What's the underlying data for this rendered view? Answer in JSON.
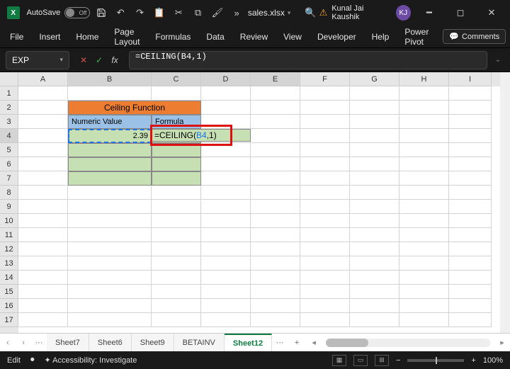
{
  "titlebar": {
    "autosave_label": "AutoSave",
    "autosave_state": "Off",
    "filename": "sales.xlsx",
    "user_name": "Kunal Jai Kaushik",
    "user_initials": "KJ"
  },
  "ribbon": {
    "tabs": [
      "File",
      "Insert",
      "Home",
      "Page Layout",
      "Formulas",
      "Data",
      "Review",
      "View",
      "Developer",
      "Help",
      "Power Pivot"
    ],
    "comments_label": "Comments"
  },
  "formulabar": {
    "namebox": "EXP",
    "formula": "=CEILING(B4,1)"
  },
  "columns": [
    "A",
    "B",
    "C",
    "D",
    "E",
    "F",
    "G",
    "H",
    "I"
  ],
  "rows_visible": 17,
  "active_row": 4,
  "active_cols": [
    "B",
    "C",
    "D",
    "E"
  ],
  "sheet": {
    "B2C2_merged": "Ceiling Function",
    "B3": "Numeric Value",
    "C3": "Formula",
    "B4": "2.39",
    "C4_edit_prefix": "=CEILING(",
    "C4_edit_ref": "B4",
    "C4_edit_suffix": ",1)"
  },
  "sheettabs": {
    "tabs": [
      "Sheet7",
      "Sheet6",
      "Sheet9",
      "BETAINV",
      "Sheet12"
    ],
    "active_index": 4
  },
  "statusbar": {
    "mode": "Edit",
    "accessibility": "Accessibility: Investigate",
    "zoom": "100%"
  }
}
